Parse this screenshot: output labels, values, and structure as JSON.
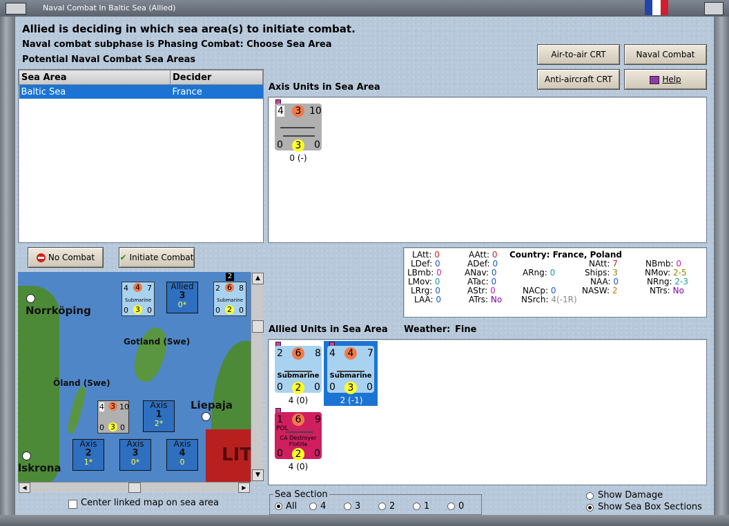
{
  "window": {
    "title": "Naval Combat In Baltic Sea (Allied)"
  },
  "header": {
    "line1": "Allied is deciding in which sea area(s) to initiate combat.",
    "line2": "Naval combat subphase is Phasing Combat: Choose Sea Area",
    "line3": "Potential Naval Combat Sea Areas"
  },
  "buttons": {
    "air_to_air": "Air-to-air CRT",
    "naval_chart": "Naval Combat Chart",
    "anti_aircraft": "Anti-aircraft CRT",
    "help": "Help",
    "no_combat": "No Combat",
    "initiate_combat": "Initiate Combat"
  },
  "sea_table": {
    "headers": [
      "Sea Area",
      "Decider"
    ],
    "rows": [
      {
        "area": "Baltic Sea",
        "decider": "France"
      }
    ]
  },
  "axis_units": {
    "title": "Axis Units in Sea Area",
    "units": [
      {
        "top": [
          "4",
          "3",
          "10"
        ],
        "bottom": [
          "0",
          "3",
          "0"
        ],
        "caption": "0 (-)"
      }
    ]
  },
  "stats": {
    "country_label": "Country: France, Poland",
    "col1": [
      {
        "k": "LAtt:",
        "v": "0"
      },
      {
        "k": "LDef:",
        "v": "0"
      },
      {
        "k": "LBmb:",
        "v": "0"
      },
      {
        "k": "LMov:",
        "v": "0"
      },
      {
        "k": "LRrg:",
        "v": "0"
      },
      {
        "k": "LAA:",
        "v": "0"
      }
    ],
    "col2": [
      {
        "k": "AAtt:",
        "v": "0"
      },
      {
        "k": "ADef:",
        "v": "0"
      },
      {
        "k": "ANav:",
        "v": "0"
      },
      {
        "k": "ATac:",
        "v": "0"
      },
      {
        "k": "AStr:",
        "v": "0"
      },
      {
        "k": "ATrs:",
        "v": "No"
      }
    ],
    "arng": {
      "k": "ARng:",
      "v": "0"
    },
    "nacp": {
      "k": "NACp:",
      "v": "0"
    },
    "nsrch": {
      "k": "NSrch:",
      "v": "4(-1R)"
    },
    "col3": [
      {
        "k": "NAtt:",
        "v": "7"
      },
      {
        "k": "Ships:",
        "v": "3"
      },
      {
        "k": "NAA:",
        "v": "0"
      },
      {
        "k": "NASW:",
        "v": "2"
      }
    ],
    "col4": [
      {
        "k": "NBmb:",
        "v": "0"
      },
      {
        "k": "NMov:",
        "v": "2-5"
      },
      {
        "k": "NRng:",
        "v": "2-3"
      },
      {
        "k": "NTrs:",
        "v": "No"
      }
    ]
  },
  "allied_units": {
    "title": "Allied Units in Sea Area",
    "weather_label": "Weather:",
    "weather_value": "Fine",
    "units": [
      {
        "top": [
          "2",
          "6",
          "8"
        ],
        "name": "Submarine",
        "bottom": [
          "0",
          "2",
          "0"
        ],
        "caption": "4 (0)"
      },
      {
        "top": [
          "4",
          "4",
          "7"
        ],
        "name": "Submarine",
        "bottom": [
          "0",
          "3",
          "0"
        ],
        "caption": "2 (-1)"
      },
      {
        "top": [
          "1",
          "6",
          "9"
        ],
        "name": "CA Destroyer Flotilla",
        "nation": "POL",
        "bottom": [
          "0",
          "2",
          "0"
        ],
        "caption": "4 (0)"
      }
    ]
  },
  "map": {
    "places": {
      "norrkoping": "Norrköping",
      "gotland": "Gotland (Swe)",
      "oland": "Öland (Swe)",
      "liepaja": "Liepaja",
      "karlskrona": "lskrona",
      "lit": "LIT"
    },
    "counter_top_left": {
      "top": [
        "4",
        "4",
        "7"
      ],
      "name": "Submarine",
      "bottom": [
        "0",
        "3",
        "0"
      ]
    },
    "counter_top_right": {
      "top": [
        "2",
        "6",
        "8"
      ],
      "name": "Submarine",
      "bottom": [
        "0",
        "2",
        "0"
      ],
      "stack": "2"
    },
    "counter_axis": {
      "top": [
        "4",
        "3",
        "10"
      ],
      "bottom": [
        "0",
        "3",
        "0"
      ]
    },
    "boxes": [
      {
        "side": "Allied",
        "num": "3",
        "sub": "0*"
      },
      {
        "side": "Axis",
        "num": "1",
        "sub": "2*"
      },
      {
        "side": "Axis",
        "num": "2",
        "sub": "1*"
      },
      {
        "side": "Axis",
        "num": "3",
        "sub": "0*"
      },
      {
        "side": "Axis",
        "num": "4",
        "sub": "0"
      }
    ]
  },
  "bottom": {
    "center_linked": "Center linked map on sea area",
    "sea_section_title": "Sea Section",
    "sea_section_options": [
      "All",
      "4",
      "3",
      "2",
      "1",
      "0"
    ],
    "show_damage": "Show Damage",
    "show_sea_box": "Show Sea Box Sections"
  }
}
